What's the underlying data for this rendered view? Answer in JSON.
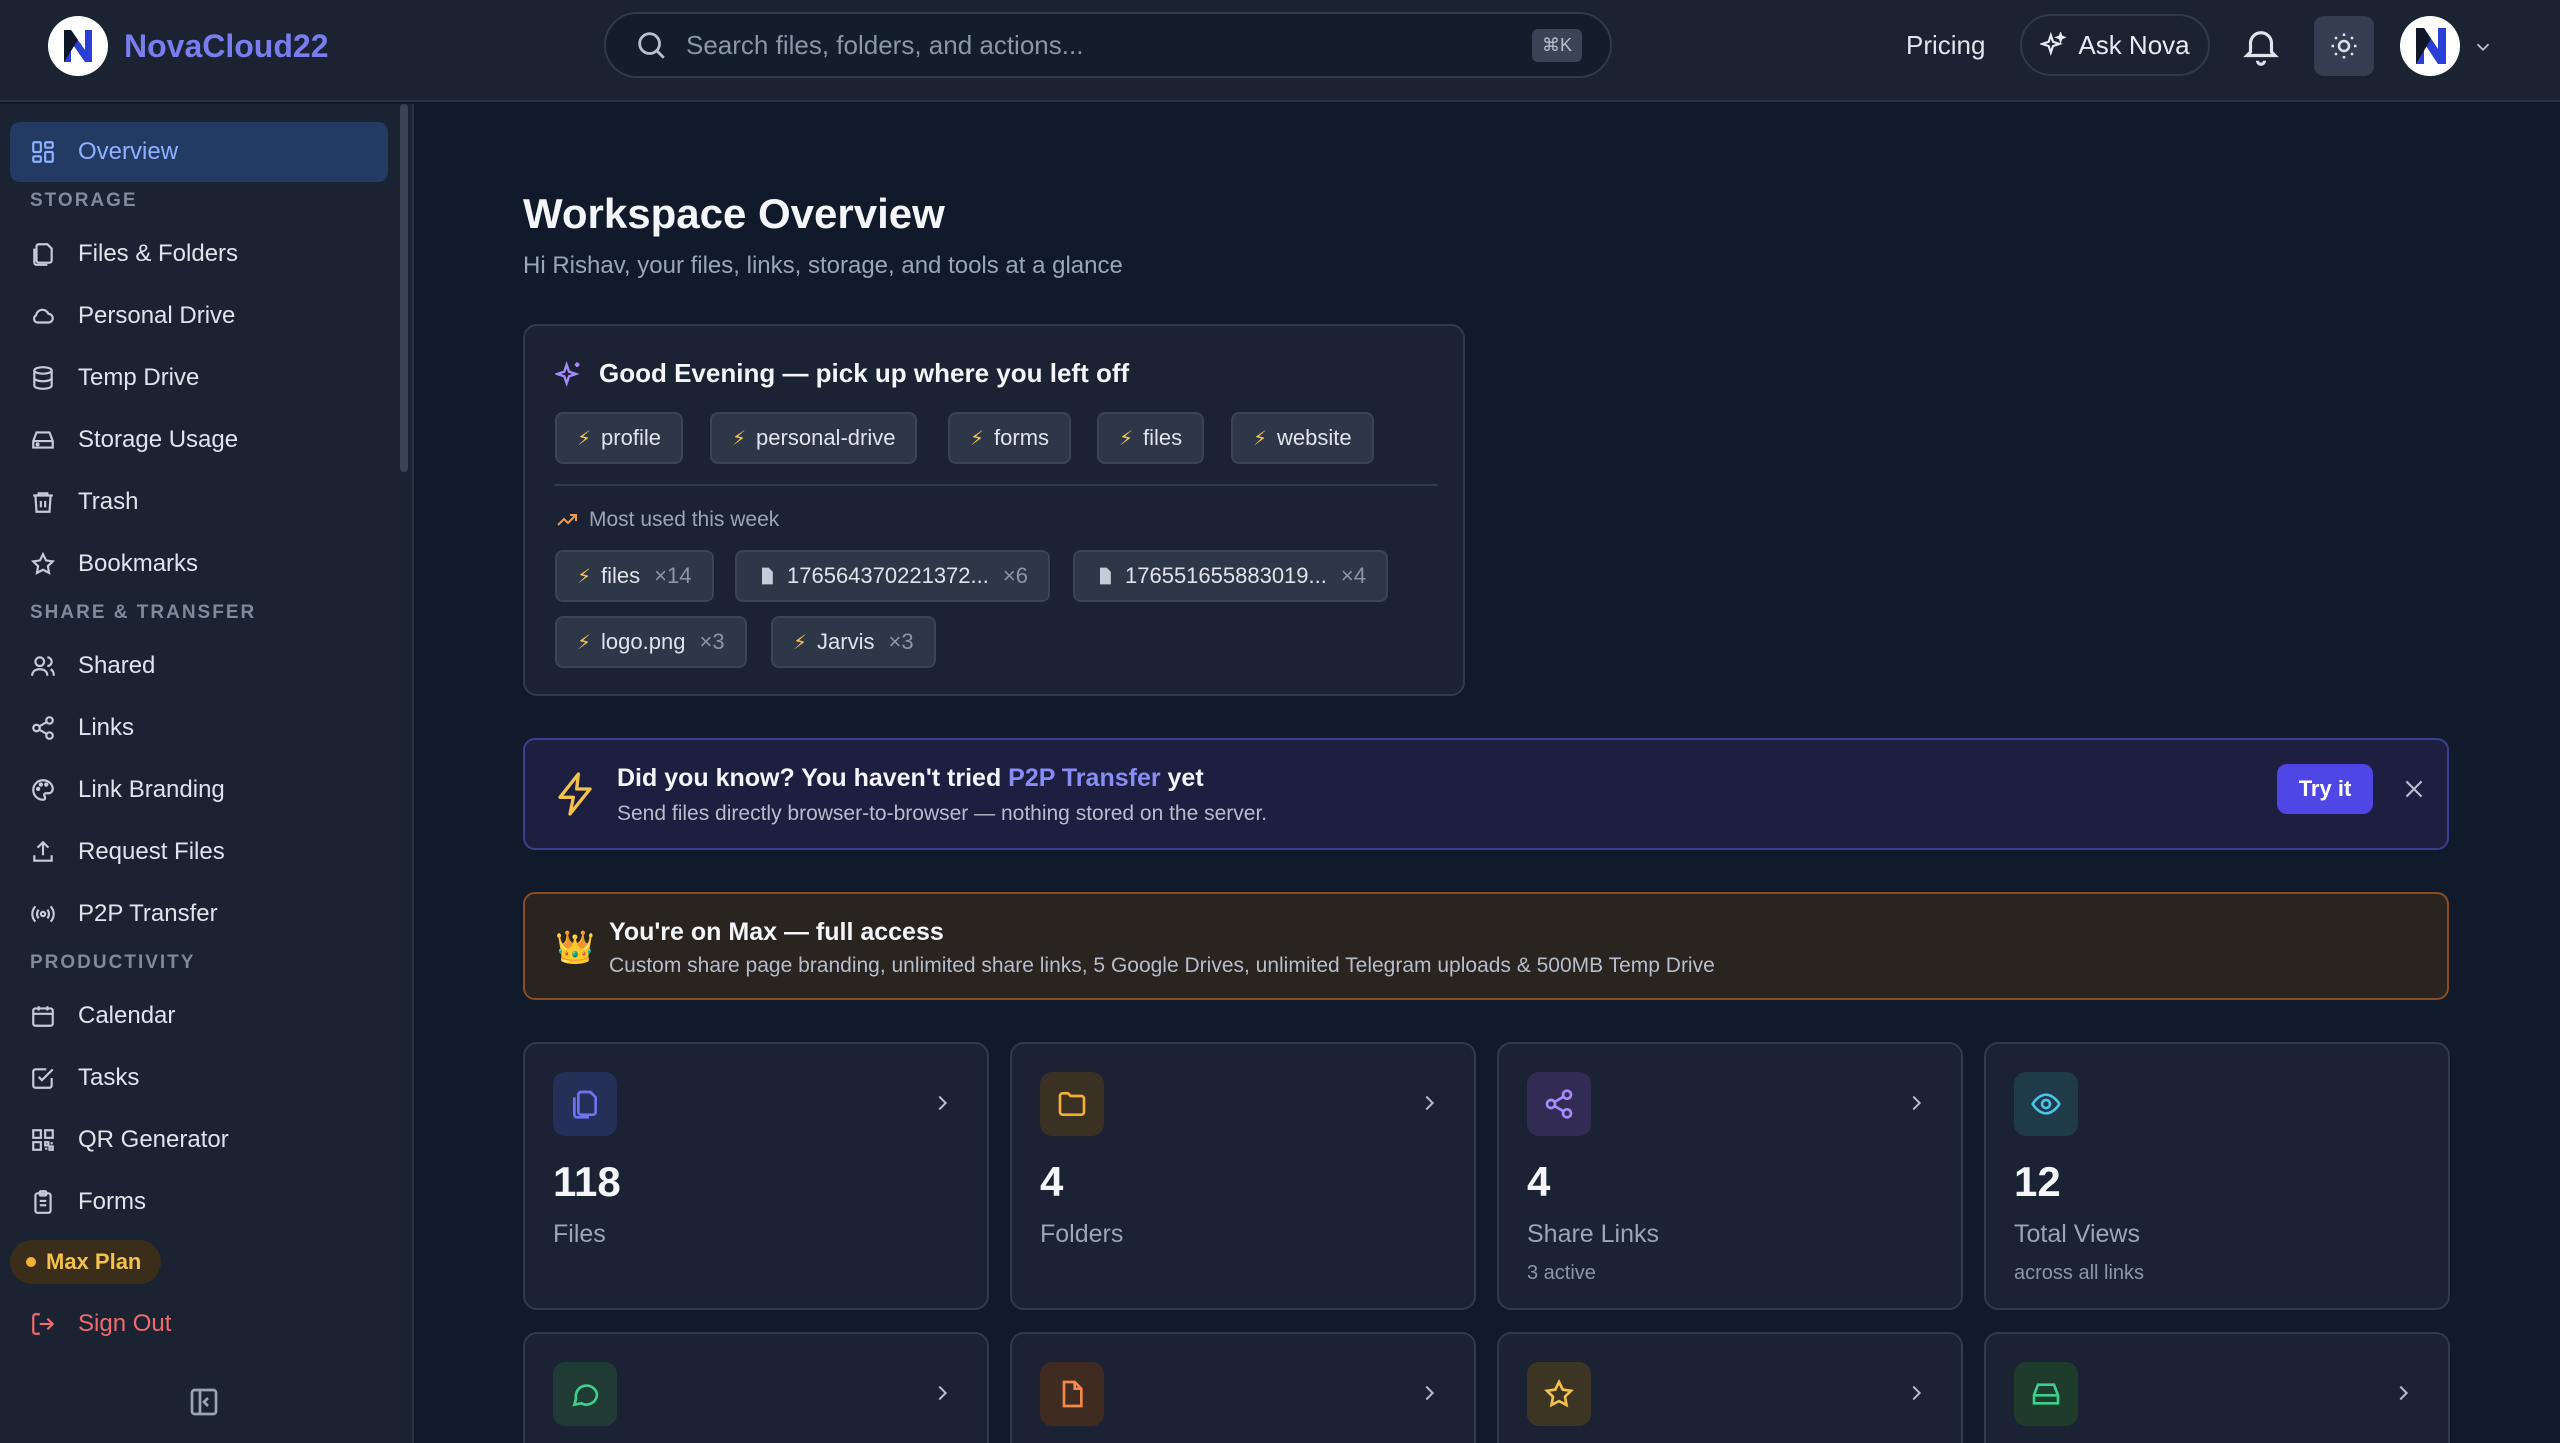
{
  "header": {
    "brand": "NovaCloud22",
    "search_placeholder": "Search files, folders, and actions...",
    "search_shortcut": "⌘K",
    "pricing": "Pricing",
    "ask_nova": "Ask Nova"
  },
  "sidebar": {
    "overview": "Overview",
    "sections": {
      "storage": "STORAGE",
      "share": "SHARE & TRANSFER",
      "productivity": "PRODUCTIVITY"
    },
    "storage_items": [
      "Files & Folders",
      "Personal Drive",
      "Temp Drive",
      "Storage Usage",
      "Trash",
      "Bookmarks"
    ],
    "share_items": [
      "Shared",
      "Links",
      "Link Branding",
      "Request Files",
      "P2P Transfer"
    ],
    "productivity_items": [
      "Calendar",
      "Tasks",
      "QR Generator",
      "Forms"
    ],
    "plan_badge": "Max Plan",
    "sign_out": "Sign Out"
  },
  "main": {
    "title": "Workspace Overview",
    "subtitle": "Hi Rishav, your files, links, storage, and tools at a glance",
    "greeting": {
      "title": "Good Evening — pick up where you left off",
      "quick_chips": [
        "profile",
        "personal-drive",
        "forms",
        "files",
        "website"
      ],
      "most_used_label": "Most used this week",
      "most_used": [
        {
          "label": "files",
          "count": "×14"
        },
        {
          "label": "176564370221372...",
          "count": "×6"
        },
        {
          "label": "176551655883019...",
          "count": "×4"
        },
        {
          "label": "logo.png",
          "count": "×3"
        },
        {
          "label": "Jarvis",
          "count": "×3"
        }
      ]
    },
    "tip": {
      "title_prefix": "Did you know? You haven't tried",
      "title_feature": "P2P Transfer",
      "title_suffix": "yet",
      "description": "Send files directly browser-to-browser — nothing stored on the server.",
      "button": "Try it"
    },
    "plan": {
      "title": "You're on Max — full access",
      "description": "Custom share page branding, unlimited share links, 5 Google Drives, unlimited Telegram uploads & 500MB Temp Drive"
    },
    "stats": [
      {
        "value": "118",
        "label": "Files",
        "sub": ""
      },
      {
        "value": "4",
        "label": "Folders",
        "sub": ""
      },
      {
        "value": "4",
        "label": "Share Links",
        "sub": "3 active"
      },
      {
        "value": "12",
        "label": "Total Views",
        "sub": "across all links"
      }
    ]
  },
  "colors": {
    "accent": "#7a7cf0",
    "tip_button": "#4f46e5",
    "plan_border": "#8a4d22",
    "sign_out": "#f06b6b"
  }
}
